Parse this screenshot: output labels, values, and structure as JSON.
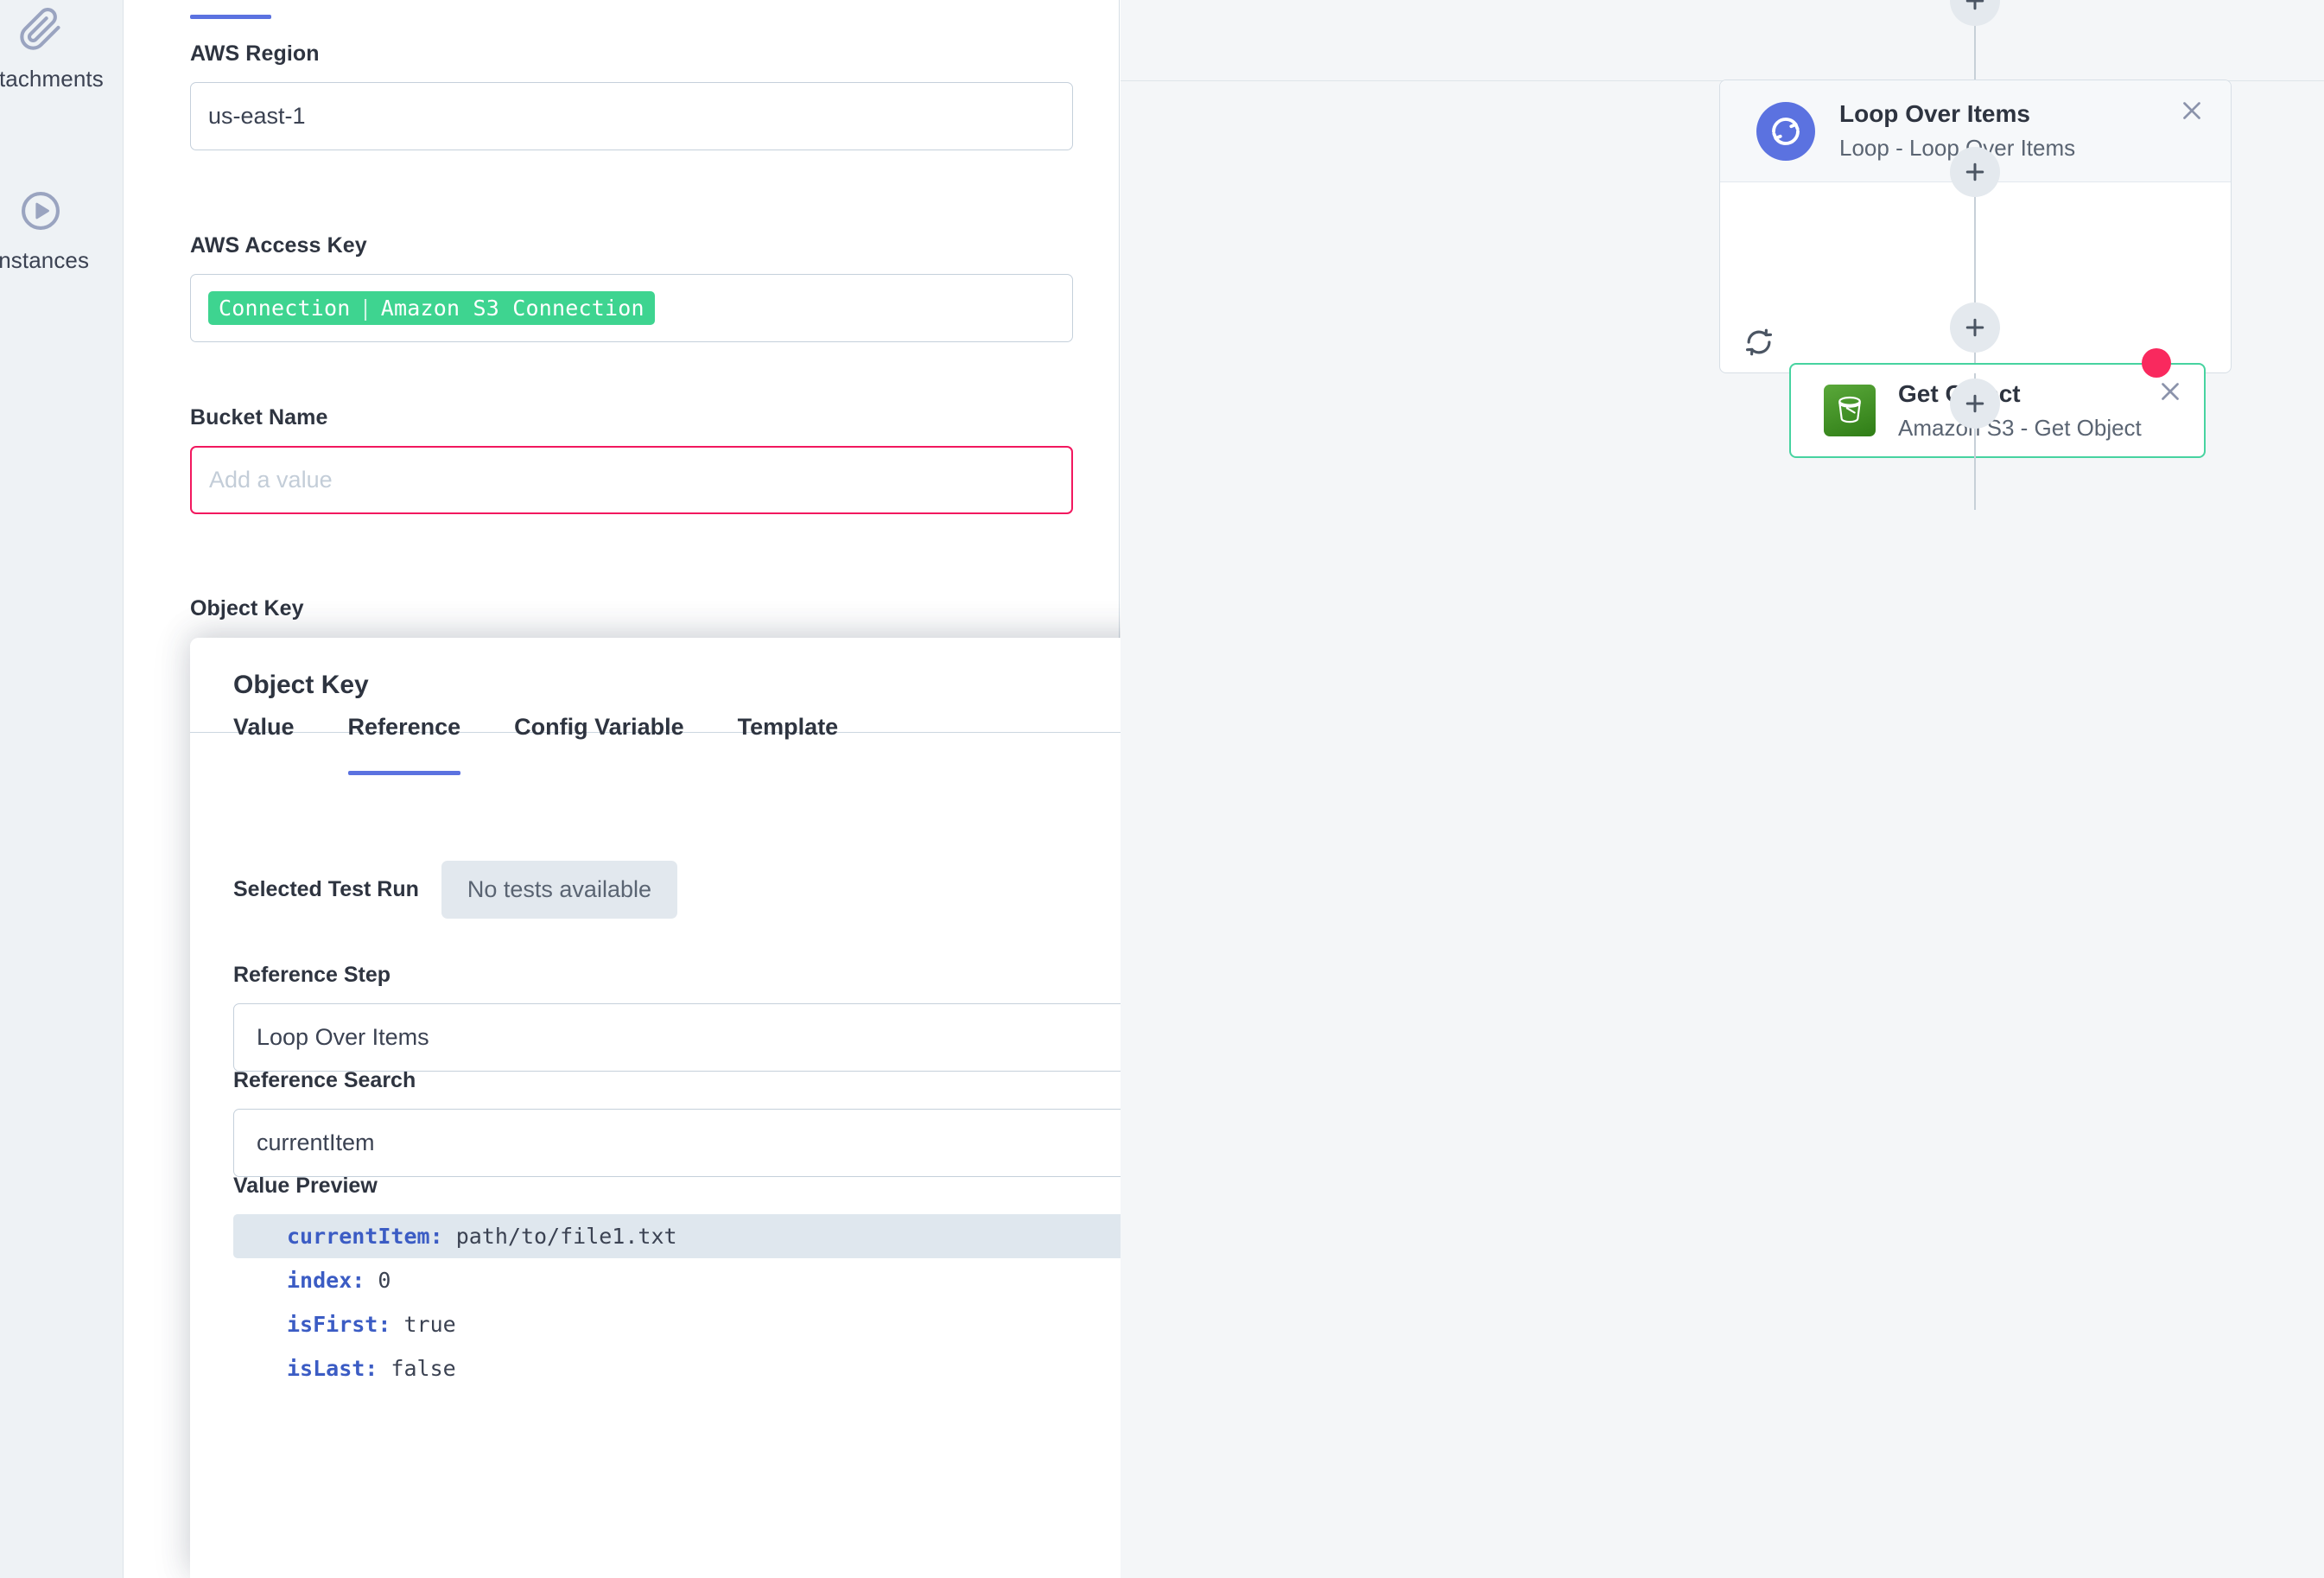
{
  "rail": {
    "items": [
      {
        "label": "Attachments",
        "icon": "paperclip-icon"
      },
      {
        "label": "Instances",
        "icon": "play-circle-icon"
      }
    ]
  },
  "form": {
    "fields": [
      {
        "label": "AWS Region",
        "value": "us-east-1",
        "placeholder": "",
        "state": "normal"
      },
      {
        "label": "AWS Access Key",
        "chip_prefix": "Connection",
        "chip_value": "Amazon S3 Connection",
        "state": "normal"
      },
      {
        "label": "Bucket Name",
        "value": "",
        "placeholder": "Add a value",
        "state": "error"
      },
      {
        "label": "Object Key"
      }
    ]
  },
  "modal": {
    "title": "Object Key",
    "confirm_icon": "check-icon",
    "tabs": [
      {
        "label": "Value",
        "active": false
      },
      {
        "label": "Reference",
        "active": true
      },
      {
        "label": "Config Variable",
        "active": false
      },
      {
        "label": "Template",
        "active": false
      }
    ],
    "test_run": {
      "label": "Selected Test Run",
      "chip": "No tests available"
    },
    "reference_step": {
      "label": "Reference Step",
      "value": "Loop Over Items"
    },
    "reference_search": {
      "label": "Reference Search",
      "value": "currentItem",
      "copy_icon": "clipboard-icon"
    },
    "value_preview": {
      "label": "Value Preview",
      "rows": [
        {
          "key": "currentItem:",
          "value": "path/to/file1.txt",
          "highlighted": true
        },
        {
          "key": "index:",
          "value": "0",
          "highlighted": false
        },
        {
          "key": "isFirst:",
          "value": "true",
          "highlighted": false
        },
        {
          "key": "isLast:",
          "value": "false",
          "highlighted": false
        }
      ]
    }
  },
  "canvas": {
    "loop_node": {
      "title": "Loop Over Items",
      "subtitle": "Loop - Loop Over Items",
      "icon": "loop-refresh-icon",
      "close_icon": "close-icon",
      "loop_back_icon": "loop-back-icon"
    },
    "s3_node": {
      "title": "Get Object",
      "subtitle": "Amazon S3 - Get Object",
      "icon": "s3-bucket-icon",
      "close_icon": "close-icon",
      "has_error": true
    },
    "add_buttons": 4
  },
  "colors": {
    "accent_blue": "#5b72e0",
    "error_pink": "#f2185f",
    "error_dot": "#f9295e",
    "connection_green": "#3ed490",
    "selection_green": "#47d3a0",
    "s3_green": "#2f7d16",
    "canvas_bg": "#f4f6f8",
    "rail_bg": "#eef2f5"
  }
}
